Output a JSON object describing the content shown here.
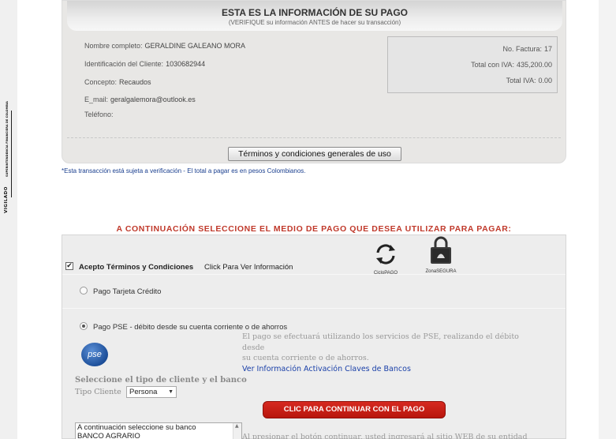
{
  "compliance": {
    "vigilado_label": "VIGILADO",
    "authority": "SUPERINTENDENCIA FINANCIERA DE COLOMBIA"
  },
  "payment_info": {
    "title": "ESTA ES LA INFORMACIÓN DE SU PAGO",
    "subtitle": "(VERIFIQUE su información ANTES de hacer su transacción)",
    "fields": {
      "full_name_label": "Nombre completo:",
      "full_name": "GERALDINE GALEANO MORA",
      "client_id_label": "Identificación del Cliente:",
      "client_id": "1030682944",
      "concept_label": "Concepto:",
      "concept": "Recaudos",
      "email_label": "E_mail:",
      "email": "geralgalemora@outlook.es",
      "phone_label": "Teléfono:",
      "phone": ""
    },
    "invoice": {
      "number_label": "No. Factura:",
      "number": "17",
      "total_label": "Total con IVA:",
      "total": "435,200.00",
      "iva_label": "Total IVA:",
      "iva": "0.00"
    },
    "terms_button": "Términos y condiciones generales de uso"
  },
  "notice": "*Esta transacción está sujeta a verificación - El total a pagar es en pesos Colombianos.",
  "payment_methods": {
    "heading": "A CONTINUACIÓN SELECCIONE EL MEDIO DE PAGO QUE DESEA UTILIZAR PARA PAGAR:",
    "accept_terms_label": "Acepto Términos y Condiciones",
    "accept_terms_link": "Click Para Ver Información",
    "accept_terms_checked": true,
    "badges": [
      {
        "icon": "cycle-arrows-icon",
        "caption": "CicloPAGO"
      },
      {
        "icon": "padlock-icon",
        "caption": "ZonaSEGURA"
      }
    ],
    "options": [
      {
        "label": "Pago Tarjeta Crédito",
        "selected": false
      },
      {
        "label": "Pago PSE - débito desde su cuenta corriente o de ahorros",
        "selected": true
      }
    ],
    "pse": {
      "logo_text": "pse",
      "description_line1": "El pago se efectuará utilizando los servicios de PSE, realizando el débito",
      "description_line2": "desde",
      "description_line3": "su cuenta corriente o de ahorros.",
      "activation_link": "Ver Información Activación Claves de Bancos",
      "client_heading": "Seleccione el tipo de cliente y el banco",
      "client_type_label": "Tipo Cliente",
      "client_type_value": "Persona",
      "continue_button": "CLIC PARA CONTINUAR CON EL PAGO",
      "bank_options": [
        "A continuación seleccione su banco",
        "BANCO AGRARIO"
      ],
      "bottom_note": "Al presionar el botón continuar, usted ingresará al sitio WEB de su entidad"
    }
  }
}
